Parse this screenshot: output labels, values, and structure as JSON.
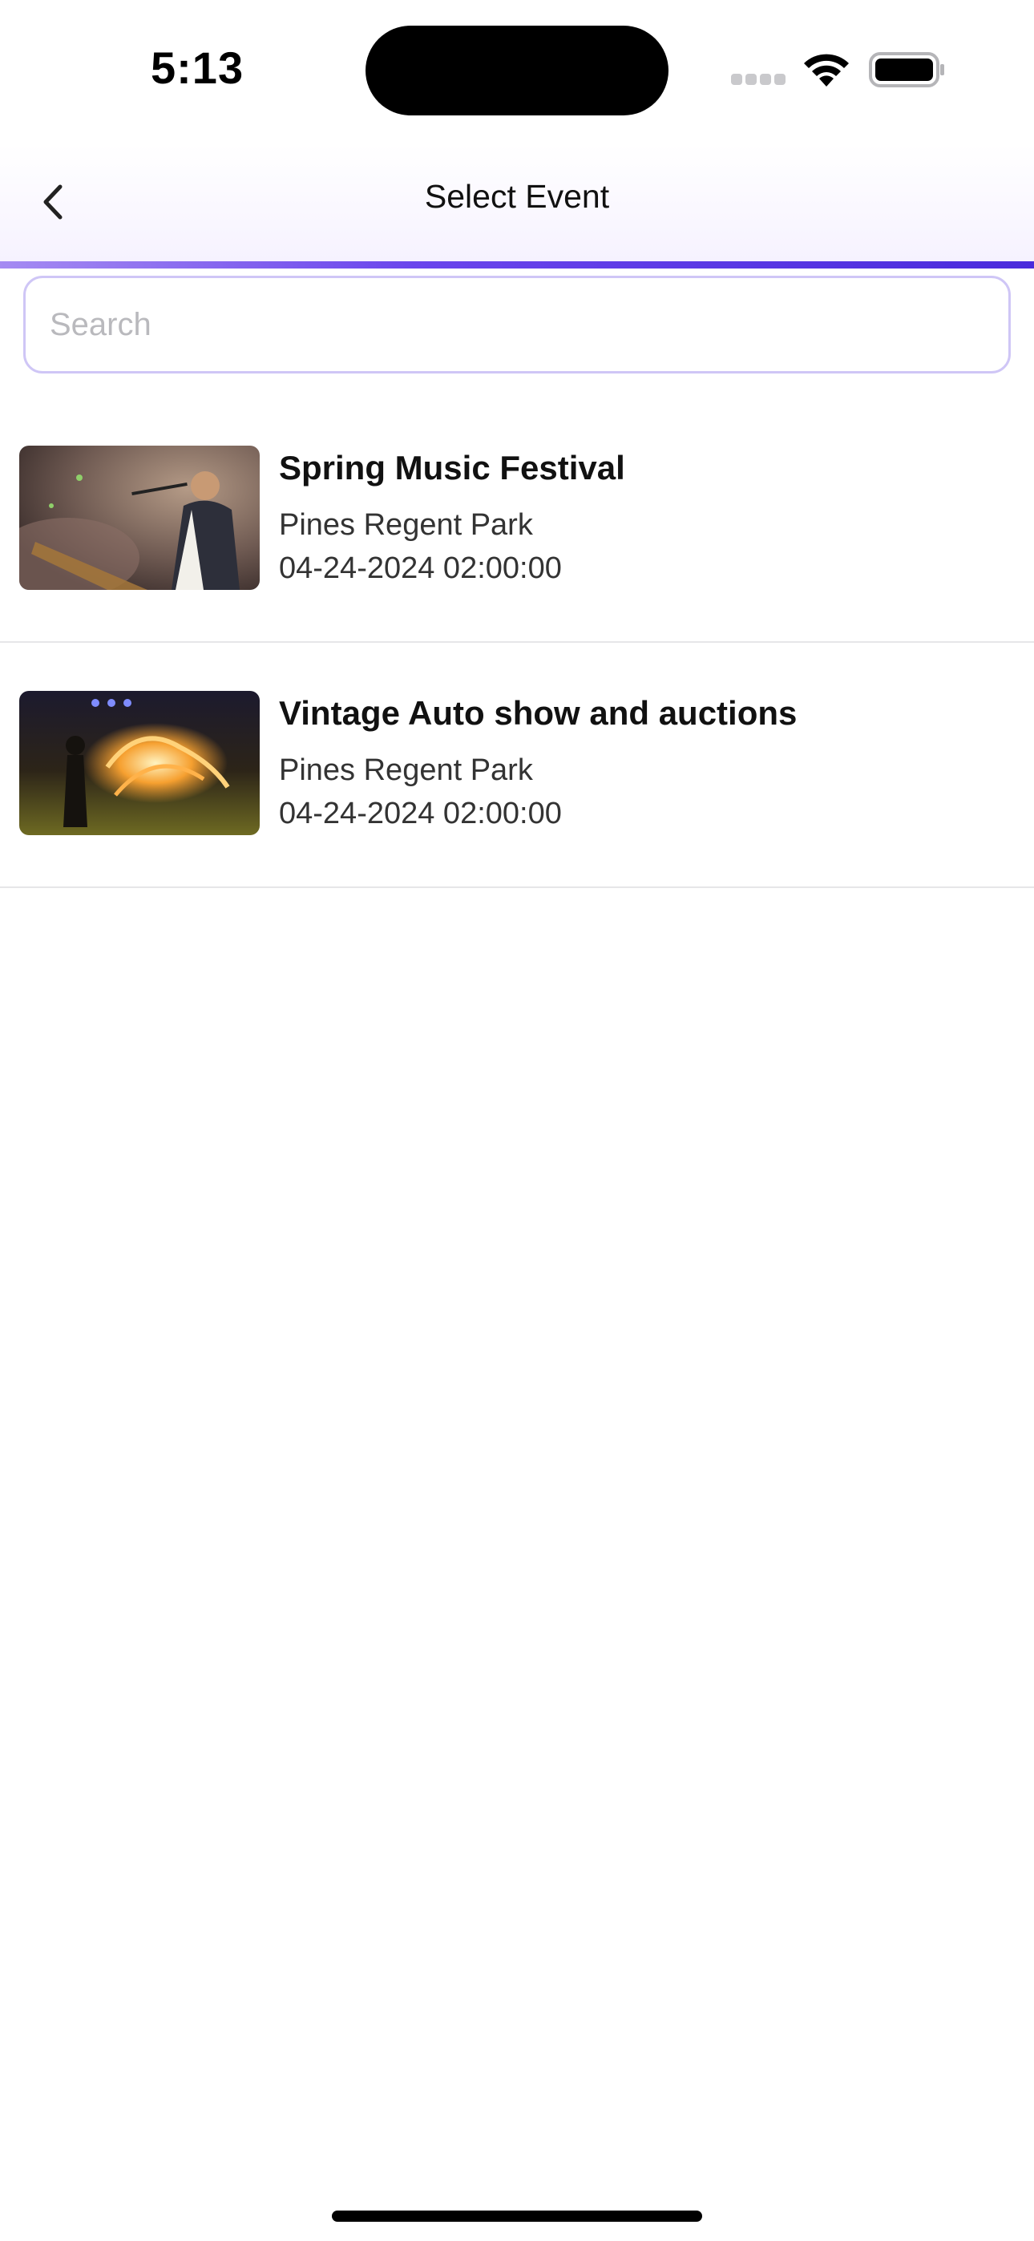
{
  "status_bar": {
    "time": "5:13"
  },
  "nav": {
    "title": "Select Event",
    "back_icon": "chevron-left-icon",
    "accent_color": "#5b3be6"
  },
  "search": {
    "placeholder": "Search",
    "value": ""
  },
  "events": [
    {
      "title": "Spring Music Festival",
      "venue": "Pines Regent Park",
      "datetime": "04-24-2024 02:00:00",
      "image": "concert-singer-photo"
    },
    {
      "title": "Vintage Auto show and auctions",
      "venue": "Pines Regent Park",
      "datetime": "04-24-2024 02:00:00",
      "image": "fire-performance-photo"
    }
  ]
}
